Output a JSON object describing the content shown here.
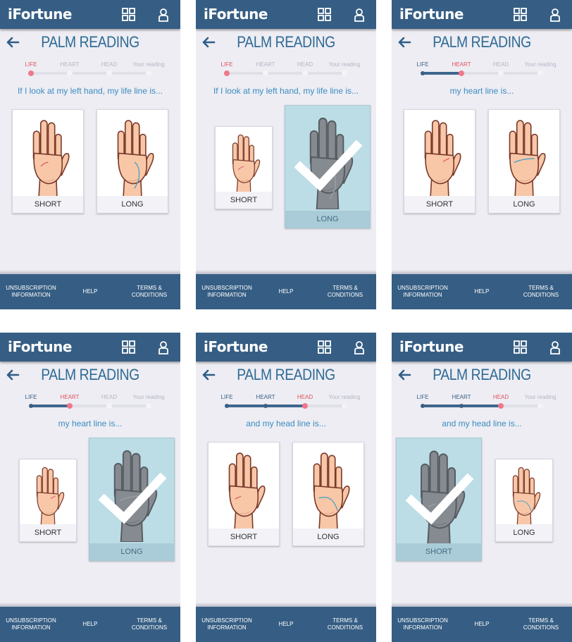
{
  "brand": {
    "name": "iFortune"
  },
  "title": "PALM READING",
  "steps": [
    "LIFE",
    "HEART",
    "HEAD",
    "Your reading"
  ],
  "footer": {
    "unsubscription": "UNSUBSCRIPTION INFORMATION",
    "help": "HELP",
    "terms": "TERMS & CONDITIONS"
  },
  "colors": {
    "header": "#365e84",
    "title": "#2f6a95",
    "question": "#3b8cc0",
    "current_step": "#e2515f",
    "selected_card": "#bcdde6"
  },
  "icons": [
    "grid-icon",
    "user-icon",
    "back-arrow-icon",
    "checkmark-icon"
  ],
  "screens": [
    {
      "question": "If I look at my left hand, my life line is...",
      "current_step": 0,
      "options": [
        {
          "label": "SHORT",
          "line": "life-short",
          "selected": false
        },
        {
          "label": "LONG",
          "line": "life-long",
          "selected": false
        }
      ]
    },
    {
      "question": "If I look at my left hand, my life line is...",
      "current_step": 0,
      "options": [
        {
          "label": "SHORT",
          "line": "life-short",
          "selected": false
        },
        {
          "label": "LONG",
          "line": "life-long",
          "selected": true
        }
      ]
    },
    {
      "question": "my heart line is...",
      "current_step": 1,
      "options": [
        {
          "label": "SHORT",
          "line": "heart-short",
          "selected": false
        },
        {
          "label": "LONG",
          "line": "heart-long",
          "selected": false
        }
      ]
    },
    {
      "question": "my heart line is...",
      "current_step": 1,
      "options": [
        {
          "label": "SHORT",
          "line": "heart-short",
          "selected": false
        },
        {
          "label": "LONG",
          "line": "heart-long",
          "selected": true
        }
      ]
    },
    {
      "question": "and my head line is...",
      "current_step": 2,
      "options": [
        {
          "label": "SHORT",
          "line": "head-short",
          "selected": false
        },
        {
          "label": "LONG",
          "line": "head-long",
          "selected": false
        }
      ]
    },
    {
      "question": "and my head line is...",
      "current_step": 2,
      "options": [
        {
          "label": "SHORT",
          "line": "head-short",
          "selected": true
        },
        {
          "label": "LONG",
          "line": "head-long",
          "selected": false
        }
      ]
    }
  ]
}
